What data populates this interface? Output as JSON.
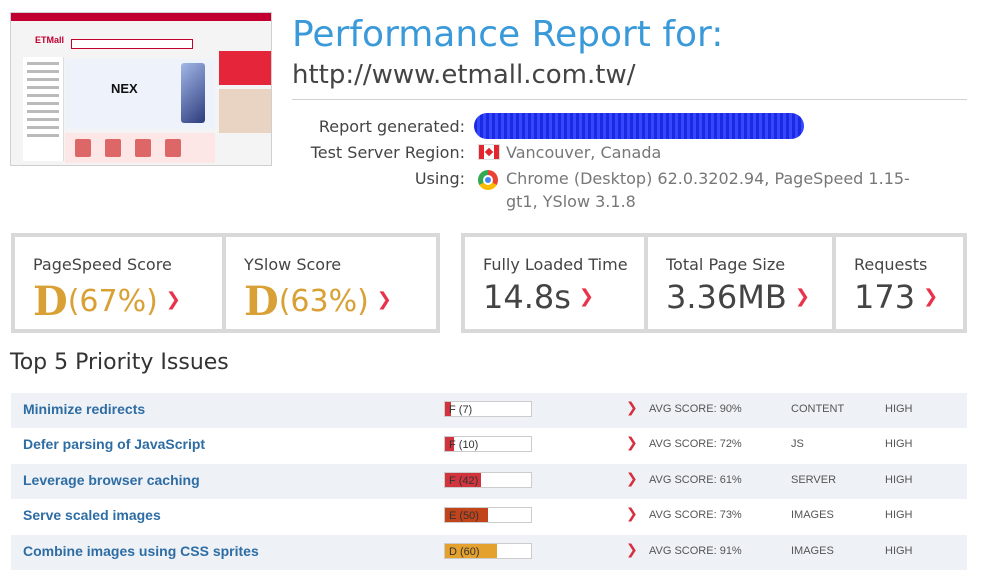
{
  "thumbnail": {
    "logo_text": "ETMall",
    "hero_text": "NEX"
  },
  "header": {
    "title": "Performance Report for:",
    "url": "http://www.etmall.com.tw/"
  },
  "info": {
    "generated_label": "Report generated:",
    "region_label": "Test Server Region:",
    "region_value": "Vancouver, Canada",
    "using_label": "Using:",
    "using_line1": "Chrome (Desktop) 62.0.3202.94, PageSpeed 1.15-",
    "using_line2": "gt1, YSlow 3.1.8"
  },
  "scores": {
    "pagespeed": {
      "label": "PageSpeed Score",
      "grade": "D",
      "value": "(67%)"
    },
    "yslow": {
      "label": "YSlow Score",
      "grade": "D",
      "value": "(63%)"
    }
  },
  "metrics": {
    "loaded": {
      "label": "Fully Loaded Time",
      "value": "14.8s"
    },
    "size": {
      "label": "Total Page Size",
      "value": "3.36MB"
    },
    "requests": {
      "label": "Requests",
      "value": "173"
    }
  },
  "issues_title": "Top 5 Priority Issues",
  "issues": [
    {
      "name": "Minimize redirects",
      "score_text": "F (7)",
      "score": 7,
      "color": "#d2343e",
      "avg": "AVG SCORE: 90%",
      "type": "CONTENT",
      "priority": "HIGH"
    },
    {
      "name": "Defer parsing of JavaScript",
      "score_text": "F (10)",
      "score": 10,
      "color": "#d2343e",
      "avg": "AVG SCORE: 72%",
      "type": "JS",
      "priority": "HIGH"
    },
    {
      "name": "Leverage browser caching",
      "score_text": "F (42)",
      "score": 42,
      "color": "#d2343e",
      "avg": "AVG SCORE: 61%",
      "type": "SERVER",
      "priority": "HIGH"
    },
    {
      "name": "Serve scaled images",
      "score_text": "E (50)",
      "score": 50,
      "color": "#c1441b",
      "avg": "AVG SCORE: 73%",
      "type": "IMAGES",
      "priority": "HIGH"
    },
    {
      "name": "Combine images using CSS sprites",
      "score_text": "D (60)",
      "score": 60,
      "color": "#e4a12d",
      "avg": "AVG SCORE: 91%",
      "type": "IMAGES",
      "priority": "HIGH"
    }
  ],
  "icons": {
    "region_flag": "canada-flag-icon",
    "browser": "chrome-icon",
    "trend": "chevron-down-icon"
  }
}
